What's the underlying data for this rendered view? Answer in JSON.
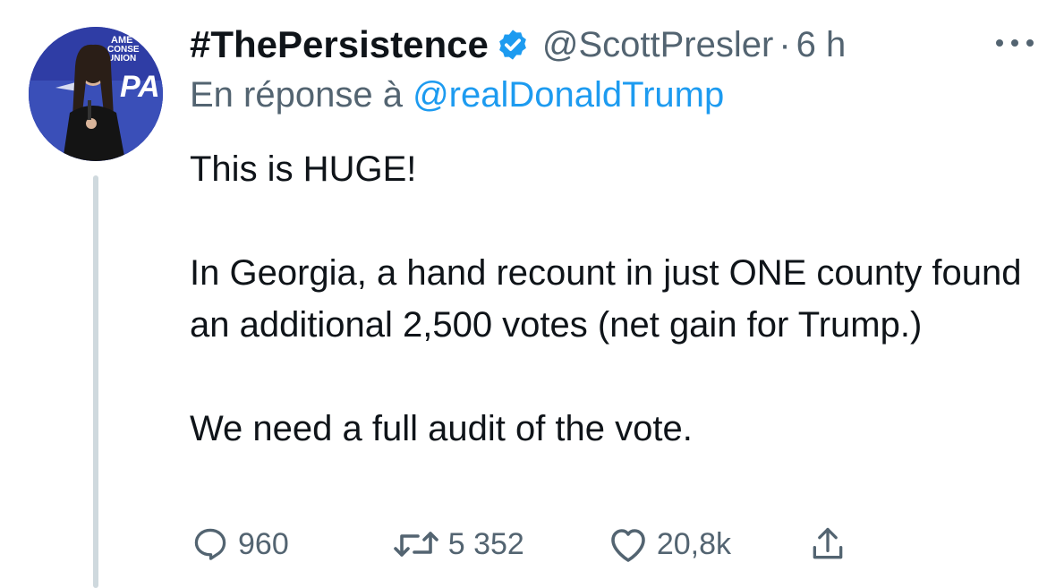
{
  "tweet": {
    "display_name": "#ThePersistence",
    "handle": "@ScottPresler",
    "separator": "·",
    "time": "6 h",
    "reply_prefix": "En réponse à",
    "reply_mention": "@realDonaldTrump",
    "body": [
      "This is HUGE!",
      "In Georgia, a hand recount in just ONE county found an additional 2,500 votes (net gain for Trump.)",
      "We need a full audit of the vote."
    ],
    "counts": {
      "replies": "960",
      "retweets": "5 352",
      "likes": "20,8k"
    },
    "avatar_banner_text": "AMERICAN CONSERVATIVE UNION",
    "avatar_logo_text": "CPA"
  },
  "colors": {
    "primary_text": "#0f1419",
    "secondary_text": "#536471",
    "link": "#1d9bf0",
    "verified": "#1d9bf0",
    "thread_line": "#cfd9de"
  },
  "icons": [
    "verified-badge-icon",
    "more-options-icon",
    "reply-icon",
    "retweet-icon",
    "like-icon",
    "share-icon"
  ]
}
